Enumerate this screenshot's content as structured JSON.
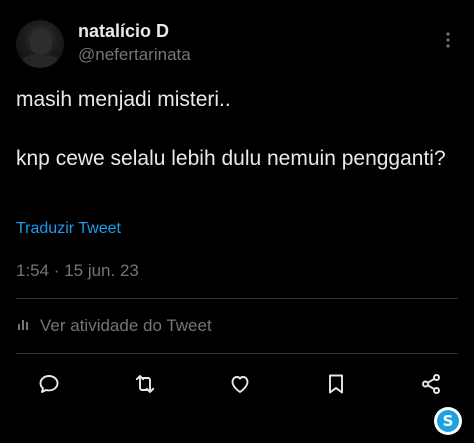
{
  "author": {
    "display_name": "natalício D",
    "handle": "@nefertarinata"
  },
  "tweet": {
    "paragraphs": [
      "masih menjadi misteri..",
      "knp cewe selalu lebih dulu nemuin pengganti?"
    ],
    "translate_label": "Traduzir Tweet",
    "timestamp": "1:54 · 15 jun. 23"
  },
  "activity": {
    "label": "Ver atividade do Tweet",
    "icon": "analytics-bars-icon"
  },
  "actions": [
    {
      "icon": "reply-icon"
    },
    {
      "icon": "retweet-icon"
    },
    {
      "icon": "like-icon"
    },
    {
      "icon": "bookmark-icon"
    },
    {
      "icon": "share-icon"
    }
  ],
  "badge": {
    "letter": "S",
    "icon": "watermark-badge-icon"
  },
  "colors": {
    "background": "#000000",
    "text": "#e7e9ea",
    "muted": "#71767b",
    "link": "#1d9bf0",
    "divider": "#2f3336"
  }
}
